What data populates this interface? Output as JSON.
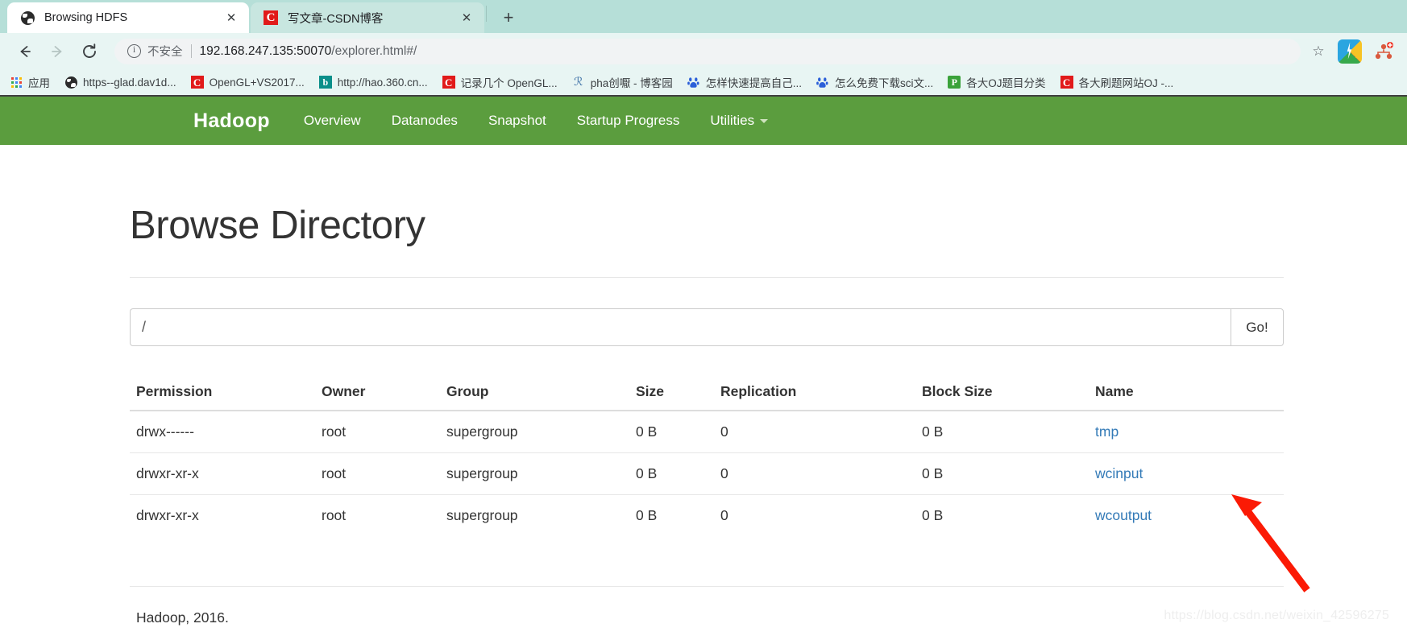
{
  "browser": {
    "tabs": [
      {
        "title": "Browsing HDFS",
        "favicon": "globe-icon",
        "active": true,
        "close_label": "✕"
      },
      {
        "title": "写文章-CSDN博客",
        "favicon": "csdn-icon",
        "active": false,
        "close_label": "✕"
      }
    ],
    "new_tab_label": "+",
    "nav": {
      "back_label": "←",
      "forward_label": "→",
      "reload_label": "⟳"
    },
    "omnibox": {
      "security_label": "不安全",
      "url_host": "192.168.247.135:50070",
      "url_path": "/explorer.html#/",
      "star_label": "☆"
    },
    "bookmarks": [
      {
        "label": "应用",
        "icon": "apps-grid-icon"
      },
      {
        "label": "https--glad.dav1d...",
        "icon": "globe-icon"
      },
      {
        "label": "OpenGL+VS2017...",
        "icon": "csdn-icon"
      },
      {
        "label": "http://hao.360.cn...",
        "icon": "bing-icon"
      },
      {
        "label": "记录几个 OpenGL...",
        "icon": "csdn-icon"
      },
      {
        "label": "pha创嚈 - 博客园",
        "icon": "cnblogs-icon"
      },
      {
        "label": "怎样快速提高自己...",
        "icon": "baidu-icon"
      },
      {
        "label": "怎么免费下载sci文...",
        "icon": "baidu-icon"
      },
      {
        "label": "各大OJ题目分类",
        "icon": "green-doc-icon"
      },
      {
        "label": "各大刷题网站OJ -...",
        "icon": "csdn-icon"
      }
    ],
    "extensions": [
      {
        "name": "sogou-input-icon"
      },
      {
        "name": "people-network-icon"
      }
    ]
  },
  "site": {
    "navbar": {
      "brand": "Hadoop",
      "links": [
        {
          "label": "Overview",
          "caret": false
        },
        {
          "label": "Datanodes",
          "caret": false
        },
        {
          "label": "Snapshot",
          "caret": false
        },
        {
          "label": "Startup Progress",
          "caret": false
        },
        {
          "label": "Utilities",
          "caret": true
        }
      ],
      "background_color": "#5b9d3e"
    },
    "page_title": "Browse Directory",
    "path_input": {
      "value": "/",
      "placeholder": "/",
      "go_label": "Go!"
    },
    "table": {
      "columns": [
        "Permission",
        "Owner",
        "Group",
        "Size",
        "Replication",
        "Block Size",
        "Name"
      ],
      "rows": [
        {
          "permission": "drwx------",
          "owner": "root",
          "group": "supergroup",
          "size": "0 B",
          "replication": "0",
          "block_size": "0 B",
          "name": "tmp"
        },
        {
          "permission": "drwxr-xr-x",
          "owner": "root",
          "group": "supergroup",
          "size": "0 B",
          "replication": "0",
          "block_size": "0 B",
          "name": "wcinput"
        },
        {
          "permission": "drwxr-xr-x",
          "owner": "root",
          "group": "supergroup",
          "size": "0 B",
          "replication": "0",
          "block_size": "0 B",
          "name": "wcoutput"
        }
      ]
    },
    "footer": "Hadoop, 2016.",
    "link_color": "#337ab7"
  },
  "annotation": {
    "arrow_color": "#fb1a05",
    "watermark": "https://blog.csdn.net/weixin_42596275"
  }
}
